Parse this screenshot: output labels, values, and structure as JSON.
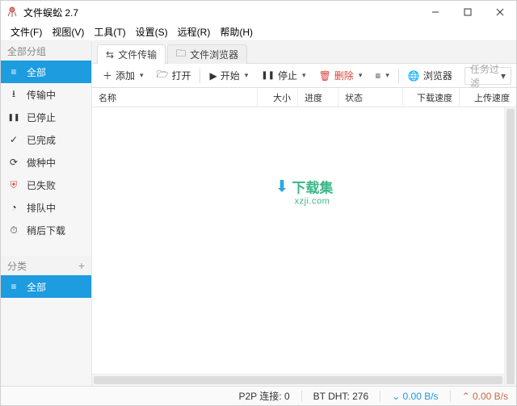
{
  "window": {
    "title": "文件蜈蚣 2.7"
  },
  "menu": {
    "file": "文件(F)",
    "view": "视图(V)",
    "tools": "工具(T)",
    "settings": "设置(S)",
    "remote": "远程(R)",
    "help": "帮助(H)"
  },
  "sidebar": {
    "group1_label": "全部分组",
    "items": [
      {
        "label": "全部",
        "icon": "≡"
      },
      {
        "label": "传输中",
        "icon": "⭳"
      },
      {
        "label": "已停止",
        "icon": "❚❚"
      },
      {
        "label": "已完成",
        "icon": "✓"
      },
      {
        "label": "做种中",
        "icon": "⟳"
      },
      {
        "label": "已失败",
        "icon": "⛨"
      },
      {
        "label": "排队中",
        "icon": "◔"
      },
      {
        "label": "稍后下载",
        "icon": "⏱"
      }
    ],
    "group2_label": "分类",
    "category_all": "全部"
  },
  "tabs": {
    "transfer": "文件传输",
    "browser": "文件浏览器"
  },
  "toolbar": {
    "add": "添加",
    "open": "打开",
    "start": "开始",
    "pause": "停止",
    "delete": "删除",
    "browser": "浏览器",
    "filter_placeholder": "任务过滤"
  },
  "columns": {
    "name": "名称",
    "size": "大小",
    "progress": "进度",
    "status": "状态",
    "download_speed": "下载速度",
    "upload_speed": "上传速度"
  },
  "watermark": {
    "arrow": "⬇",
    "text": "下载集",
    "sub": "xzji.com"
  },
  "status": {
    "p2p_label": "P2P 连接:",
    "p2p_value": "0",
    "dht_label": "BT DHT:",
    "dht_value": "276",
    "down_icon": "⌄",
    "down_value": "0.00 B/s",
    "up_icon": "⌃",
    "up_value": "0.00 B/s"
  }
}
